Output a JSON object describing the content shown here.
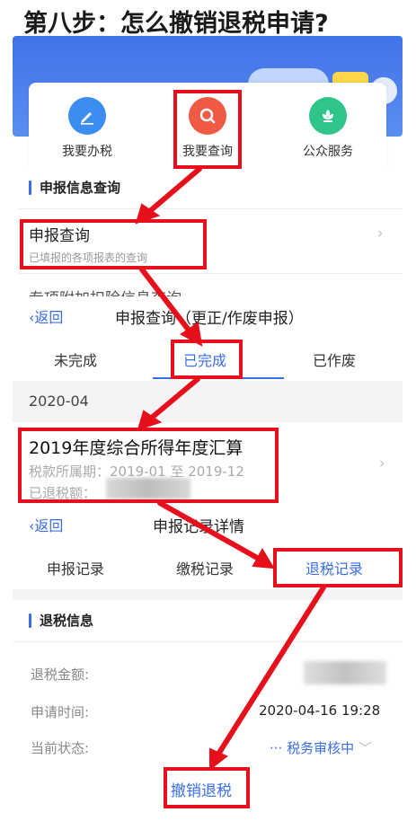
{
  "title": "第八步：怎么撤销退税申请?",
  "accent_color": "#3a6ee8",
  "annotation_color": "#e5101b",
  "services": [
    {
      "label": "我要办税",
      "icon": "pencil-icon",
      "color": "#3b8df0"
    },
    {
      "label": "我要查询",
      "icon": "magnifier-icon",
      "color": "#f05a45"
    },
    {
      "label": "公众服务",
      "icon": "flower-icon",
      "color": "#2fc48a"
    }
  ],
  "report_section": {
    "heading": "申报信息查询",
    "query_title": "申报查询",
    "query_subtitle": "已填报的各项报表的查询",
    "cut_row": "专项附加扣除信息查询"
  },
  "report_query_page": {
    "back": "返回",
    "title": "申报查询（更正/作废申报）",
    "tabs": [
      "未完成",
      "已完成",
      "已作废"
    ],
    "active_tab": "已完成",
    "month": "2020-04",
    "record": {
      "title": "2019年度综合所得年度汇算",
      "period": "税款所属期：2019-01 至 2019-12",
      "refunded_label": "已退税额："
    }
  },
  "record_detail_page": {
    "back": "返回",
    "title": "申报记录详情",
    "tabs": [
      "申报记录",
      "缴税记录",
      "退税记录"
    ],
    "info_heading": "退税信息",
    "amount_label": "退税金额:",
    "time_label": "申请时间:",
    "time_value": "2020-04-16 19:28",
    "status_label": "当前状态:",
    "status_value": "··· 税务审核中",
    "cancel_button": "撤销退税"
  }
}
